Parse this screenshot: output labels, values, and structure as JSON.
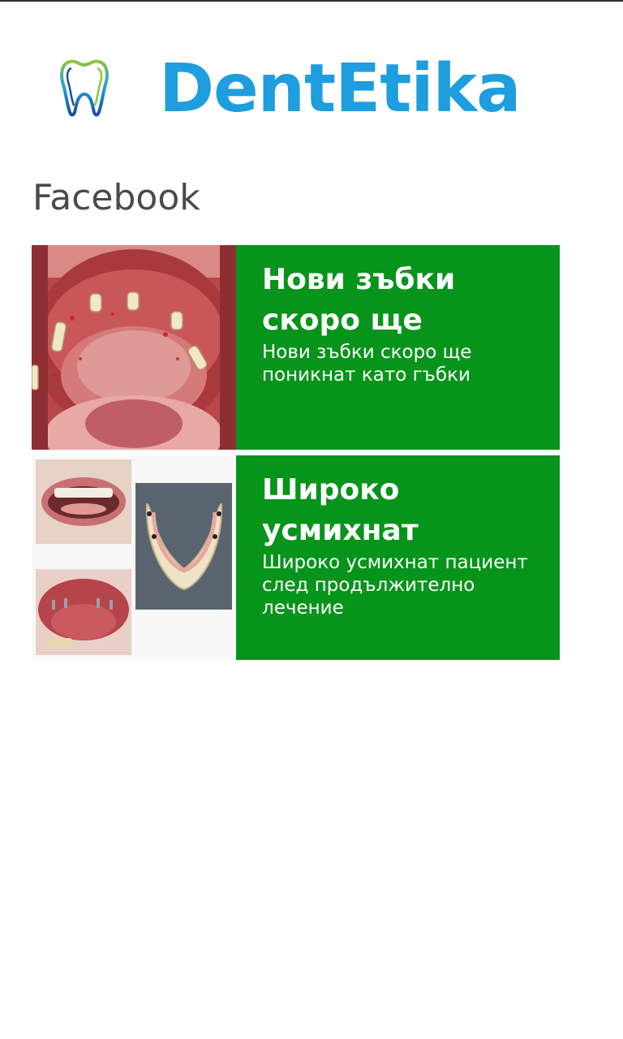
{
  "header": {
    "brand": "DentEtika",
    "logo_icon": "tooth-logo-icon"
  },
  "section": {
    "title": "Facebook"
  },
  "posts": [
    {
      "title": "Нови зъбки скоро ще",
      "text": "Нови зъбки скоро ще поникнат като гъбки",
      "image": "mouth-implants-photo"
    },
    {
      "title": "Широко усмихнат",
      "text": "Широко усмихнат пациент след продължително лечение",
      "image": "smile-denture-collage-photo"
    }
  ],
  "colors": {
    "brand": "#1e9ddf",
    "post_background": "#07941b",
    "section_title": "#4a4a4a"
  }
}
